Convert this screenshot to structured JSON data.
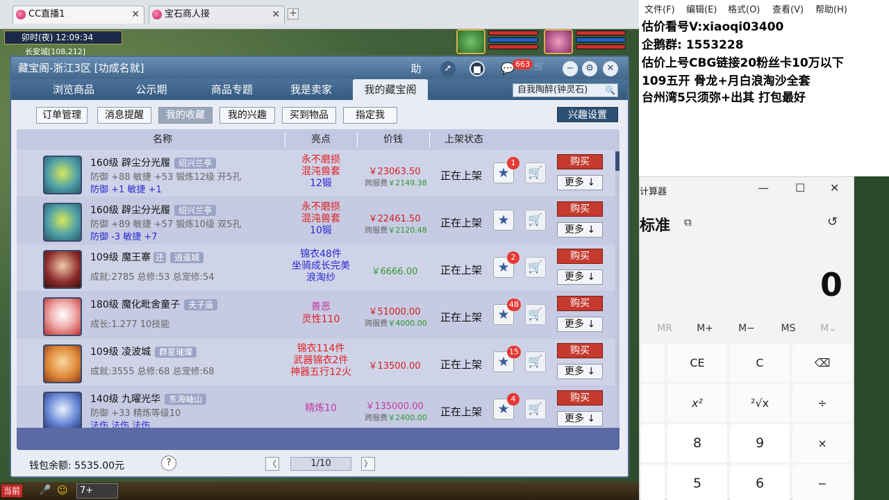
{
  "browser_tabs": [
    {
      "label": "CC直播1",
      "close": "✕"
    },
    {
      "label": "宝石商人接",
      "close": "✕"
    }
  ],
  "new_tab": "+",
  "game": {
    "clock": "卯时(夜)  12:09:34",
    "location": "长安城[108,212]"
  },
  "panel": {
    "title": "藏宝阁-浙江3区 [功成名就]",
    "help_icon": "助",
    "chat_badge": "663",
    "nav_tabs": [
      "浏览商品",
      "公示期",
      "商品专题",
      "我是卖家",
      "我的藏宝阁"
    ],
    "active_nav": "我的藏宝阁",
    "search_value": "自我陶醉(钟灵石)",
    "sub_buttons": [
      "订单管理",
      "消息提醒",
      "我的收藏",
      "我的兴趣",
      "买到物品",
      "指定我"
    ],
    "active_sub": "我的收藏",
    "interest_settings": "兴趣设置",
    "columns": {
      "name": "名称",
      "highlight": "亮点",
      "price": "价钱",
      "status": "上架状态"
    },
    "rows": [
      {
        "name": "160级 辟尘分光履",
        "tag": "绍兴兰亭",
        "tag2": "",
        "line1": "防御 +88 敏捷 +53 锻炼12级 开5孔",
        "line2": "防御 +1 敏捷 +1",
        "highlight": [
          "永不磨损",
          "混沌兽套",
          "12锻"
        ],
        "highlight_colors": [
          "#e02020",
          "#e02020",
          "#2a2ad0"
        ],
        "price": "￥23063.50",
        "fee_label": "跨服费",
        "fee": "￥2149.38",
        "status": "正在上架",
        "star_count": "1",
        "buy": "购买",
        "more": "更多 ↓"
      },
      {
        "name": "160级 辟尘分光履",
        "tag": "绍兴兰亭",
        "tag2": "",
        "line1": "防御 +89 敏捷 +57 锻炼10级 双5孔",
        "line2": "防御 -3 敏捷 +7",
        "highlight": [
          "永不磨损",
          "混沌兽套",
          "10锻"
        ],
        "highlight_colors": [
          "#e02020",
          "#e02020",
          "#2a2ad0"
        ],
        "price": "￥22461.50",
        "fee_label": "跨服费",
        "fee": "￥2120.48",
        "status": "正在上架",
        "star_count": "",
        "buy": "购买",
        "more": "更多 ↓"
      },
      {
        "name": "109级 魔王寨",
        "tag": "逍遥城",
        "tag2": "还",
        "line1": "成就:2785 总修:53 总宠修:54",
        "line2": "",
        "highlight": [
          "锦衣48件",
          "坐骑成长完美",
          "浪淘纱"
        ],
        "highlight_colors": [
          "#2a2ad0",
          "#2a2ad0",
          "#2a2ad0"
        ],
        "price": "￥6666.00",
        "fee_label": "",
        "fee": "",
        "status": "正在上架",
        "star_count": "2",
        "buy": "购买",
        "more": "更多 ↓"
      },
      {
        "name": "180级 魔化毗舍童子",
        "tag": "夫子庙",
        "tag2": "",
        "line1": "成长:1.277 10技能",
        "line2": "",
        "highlight": [
          "善恶",
          "灵性110"
        ],
        "highlight_colors": [
          "#c03aa0",
          "#e02020"
        ],
        "price": "￥51000.00",
        "fee_label": "跨服费",
        "fee": "￥4000.00",
        "status": "正在上架",
        "star_count": "48",
        "buy": "购买",
        "more": "更多 ↓"
      },
      {
        "name": "109级 凌波城",
        "tag": "群星璀璨",
        "tag2": "",
        "line1": "成就:3555 总修:68 总宠修:68",
        "line2": "",
        "highlight": [
          "锦衣114件",
          "武器锦衣2件",
          "神器五行12火"
        ],
        "highlight_colors": [
          "#e02020",
          "#e02020",
          "#e02020"
        ],
        "price": "￥13500.00",
        "fee_label": "",
        "fee": "",
        "status": "正在上架",
        "star_count": "15",
        "buy": "购买",
        "more": "更多 ↓"
      },
      {
        "name": "140级 九曜光华",
        "tag": "东海岫山",
        "tag2": "",
        "line1": "防御 +33 精炼等级10",
        "line2": "法伤 法伤 法伤",
        "highlight": [
          "精炼10"
        ],
        "highlight_colors": [
          "#c03aa0"
        ],
        "price": "￥135000.00",
        "fee_label": "跨服费",
        "fee": "￥2400.00",
        "status": "正在上架",
        "star_count": "4",
        "buy": "购买",
        "more": "更多 ↓"
      }
    ],
    "wallet": "钱包余额: 5535.00元",
    "help_q": "?",
    "pager": "1/10",
    "prev": "〈",
    "next": "〉"
  },
  "bottom_bar": {
    "current": "当前",
    "level_input": "7+"
  },
  "notepad": {
    "menu": [
      "文件(F)",
      "编辑(E)",
      "格式(O)",
      "查看(V)",
      "帮助(H)"
    ],
    "lines": [
      "估价看号V:xiaoqi03400",
      "企鹅群: 1553228",
      "估价上号CBG链接20粉丝卡10万以下",
      "109五开 骨龙+月白浪淘沙全套",
      "台州湾5只须弥+出其 打包最好"
    ]
  },
  "calculator": {
    "title": "计算器",
    "mode": "标准",
    "display": "0",
    "memory": [
      "MR",
      "M+",
      "M−",
      "MS",
      "M⌄"
    ],
    "keys": [
      {
        "label": "CE"
      },
      {
        "label": "C"
      },
      {
        "label": "⌫"
      },
      {
        "label": "x²"
      },
      {
        "label": "²√x"
      },
      {
        "label": "÷"
      },
      {
        "label": "8"
      },
      {
        "label": "9"
      },
      {
        "label": "×"
      },
      {
        "label": "5"
      },
      {
        "label": "6"
      },
      {
        "label": "−"
      }
    ]
  }
}
